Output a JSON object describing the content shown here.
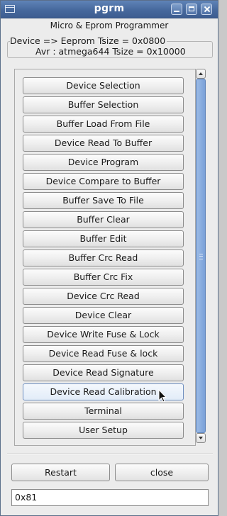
{
  "window": {
    "title": "pgrm"
  },
  "header": {
    "heading": "Micro & Eprom Programmer",
    "device_info": "Device => Eeprom Tsize = 0x0800",
    "avr_info": "Avr : atmega644  Tsize = 0x10000"
  },
  "menu": {
    "items": [
      "Device Selection",
      "Buffer Selection",
      "Buffer Load From File",
      "Device Read To Buffer",
      "Device Program",
      "Device Compare to Buffer",
      "Buffer Save To File",
      "Buffer Clear",
      "Buffer Edit",
      "Buffer Crc Read",
      "Buffer Crc Fix",
      "Device Crc Read",
      "Device Clear",
      "Device Write Fuse & Lock",
      "Device Read Fuse & lock",
      "Device Read Signature",
      "Device Read Calibration",
      "Terminal",
      "User Setup"
    ],
    "hovered": "Device Read Calibration"
  },
  "footer": {
    "restart_label": "Restart",
    "close_label": "close"
  },
  "status": {
    "value": "0x81"
  },
  "icons": [
    "window-menu-icon",
    "minimize-icon",
    "maximize-icon",
    "close-icon",
    "scroll-up-icon",
    "scroll-down-icon",
    "mouse-cursor-icon"
  ],
  "colors": {
    "titlebar": "#46689d",
    "scroll_thumb": "#7aa1d8",
    "hover_border": "#6f8fbf"
  }
}
